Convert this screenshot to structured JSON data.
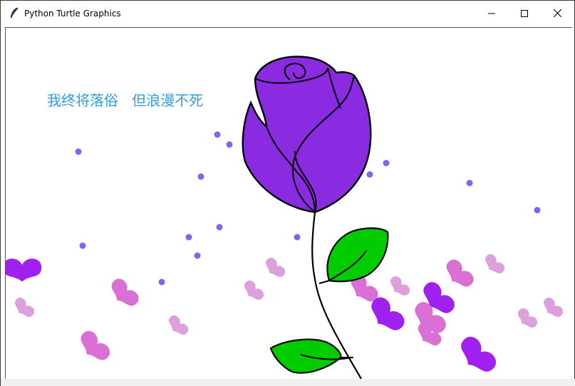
{
  "window": {
    "title": "Python Turtle Graphics",
    "icon": "feather-quill-icon",
    "controls": [
      "minimize-icon",
      "maximize-icon",
      "close-icon"
    ]
  },
  "canvas": {
    "caption": "我终将落俗   但浪漫不死",
    "caption_color": "#2f9fdc",
    "colors": {
      "petal": "#8a2be2",
      "leaf": "#00cc00",
      "dot": "#7b68ee",
      "heart_purple": "#a020f0",
      "heart_orchid": "#da70d6",
      "heart_plum": "#dda0dd",
      "outline": "#000000"
    }
  }
}
